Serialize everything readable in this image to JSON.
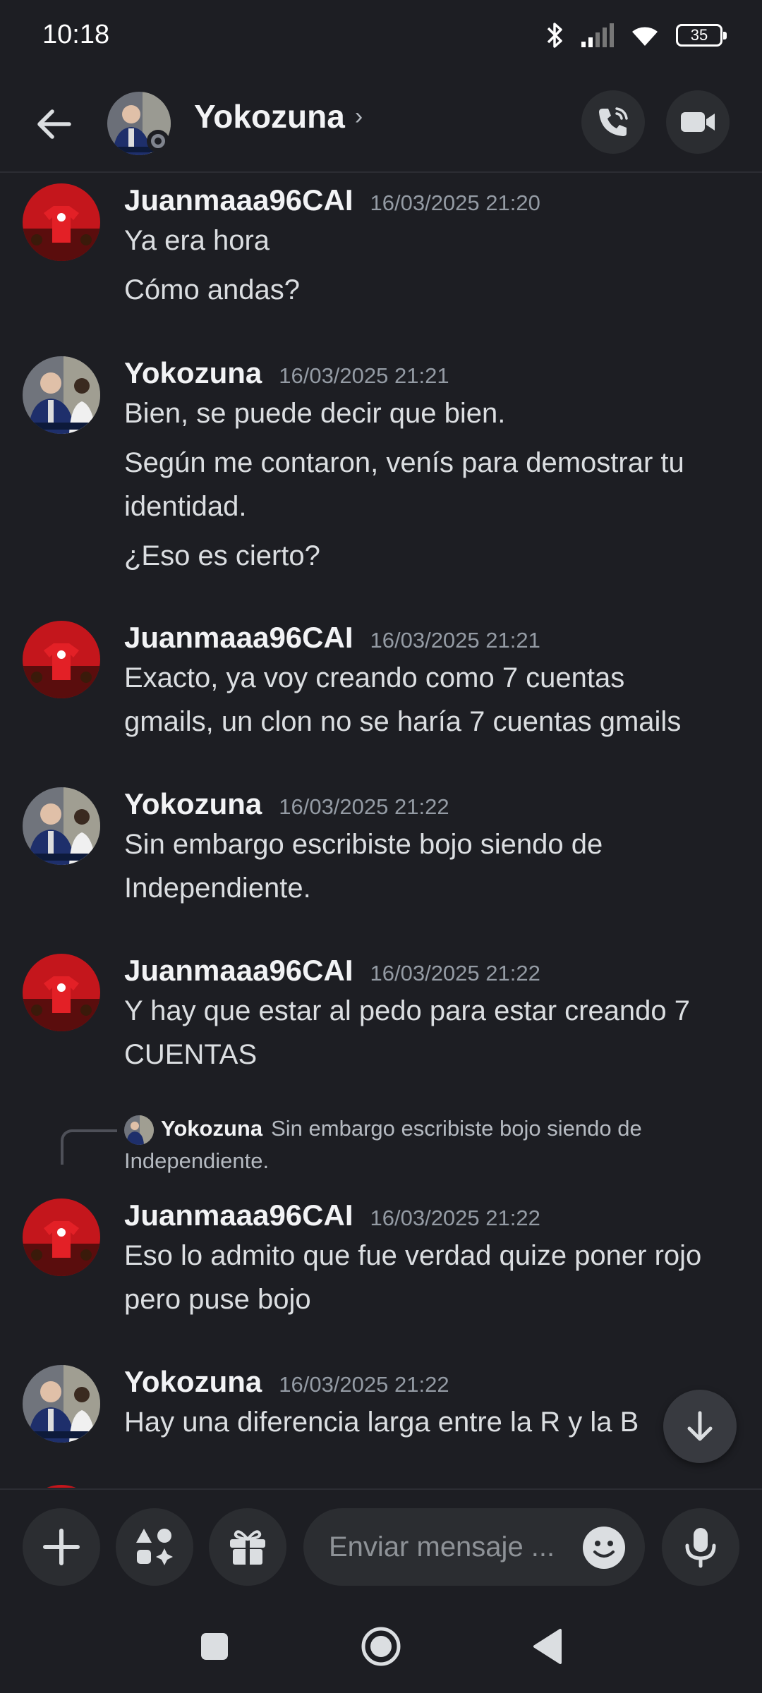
{
  "status_bar": {
    "time": "10:18",
    "battery": "35"
  },
  "header": {
    "title": "Yokozuna",
    "chevron": "›"
  },
  "messages": [
    {
      "author": "Juanmaaa96CAI",
      "timestamp": "16/03/2025 21:20",
      "lines": [
        "Ya era hora",
        "Cómo andas?"
      ]
    },
    {
      "author": "Yokozuna",
      "timestamp": "16/03/2025 21:21",
      "lines": [
        "Bien, se puede decir que bien.",
        "Según me contaron, venís para demostrar tu",
        "identidad.",
        "¿Eso es cierto?"
      ]
    },
    {
      "author": "Juanmaaa96CAI",
      "timestamp": "16/03/2025 21:21",
      "lines": [
        "Exacto, ya voy creando como 7 cuentas",
        "gmails, un clon no se haría 7 cuentas gmails"
      ]
    },
    {
      "author": "Yokozuna",
      "timestamp": "16/03/2025 21:22",
      "lines": [
        "Sin embargo escribiste bojo siendo de",
        "Independiente."
      ]
    },
    {
      "author": "Juanmaaa96CAI",
      "timestamp": "16/03/2025 21:22",
      "lines": [
        "Y hay que estar al pedo para estar creando 7",
        "CUENTAS"
      ]
    },
    {
      "author": "Juanmaaa96CAI",
      "timestamp": "16/03/2025 21:22",
      "lines": [
        "Eso lo admito que fue verdad quize poner rojo",
        "pero puse bojo"
      ]
    },
    {
      "author": "Yokozuna",
      "timestamp": "16/03/2025 21:22",
      "lines": [
        "Hay una diferencia larga entre la R y la B"
      ]
    }
  ],
  "reply": {
    "author": "Yokozuna",
    "text_line1": "Sin embargo escribiste bojo siendo de",
    "text_line2": "Independiente."
  },
  "composer": {
    "placeholder": "Enviar mensaje ..."
  },
  "icons": {
    "back": "arrow-left-icon",
    "call": "phone-call-icon",
    "video": "video-camera-icon",
    "add": "plus-icon",
    "apps": "apps-icon",
    "gift": "gift-icon",
    "emoji": "emoji-icon",
    "mic": "microphone-icon",
    "jump": "arrow-down-icon",
    "nav_recents": "square-icon",
    "nav_home": "circle-icon",
    "nav_back": "triangle-icon"
  },
  "colors": {
    "background": "#1d1e23",
    "surface": "#2b2d31",
    "text": "#dbdee1",
    "muted": "#949ba4",
    "avatar_red": "#c4161c"
  }
}
